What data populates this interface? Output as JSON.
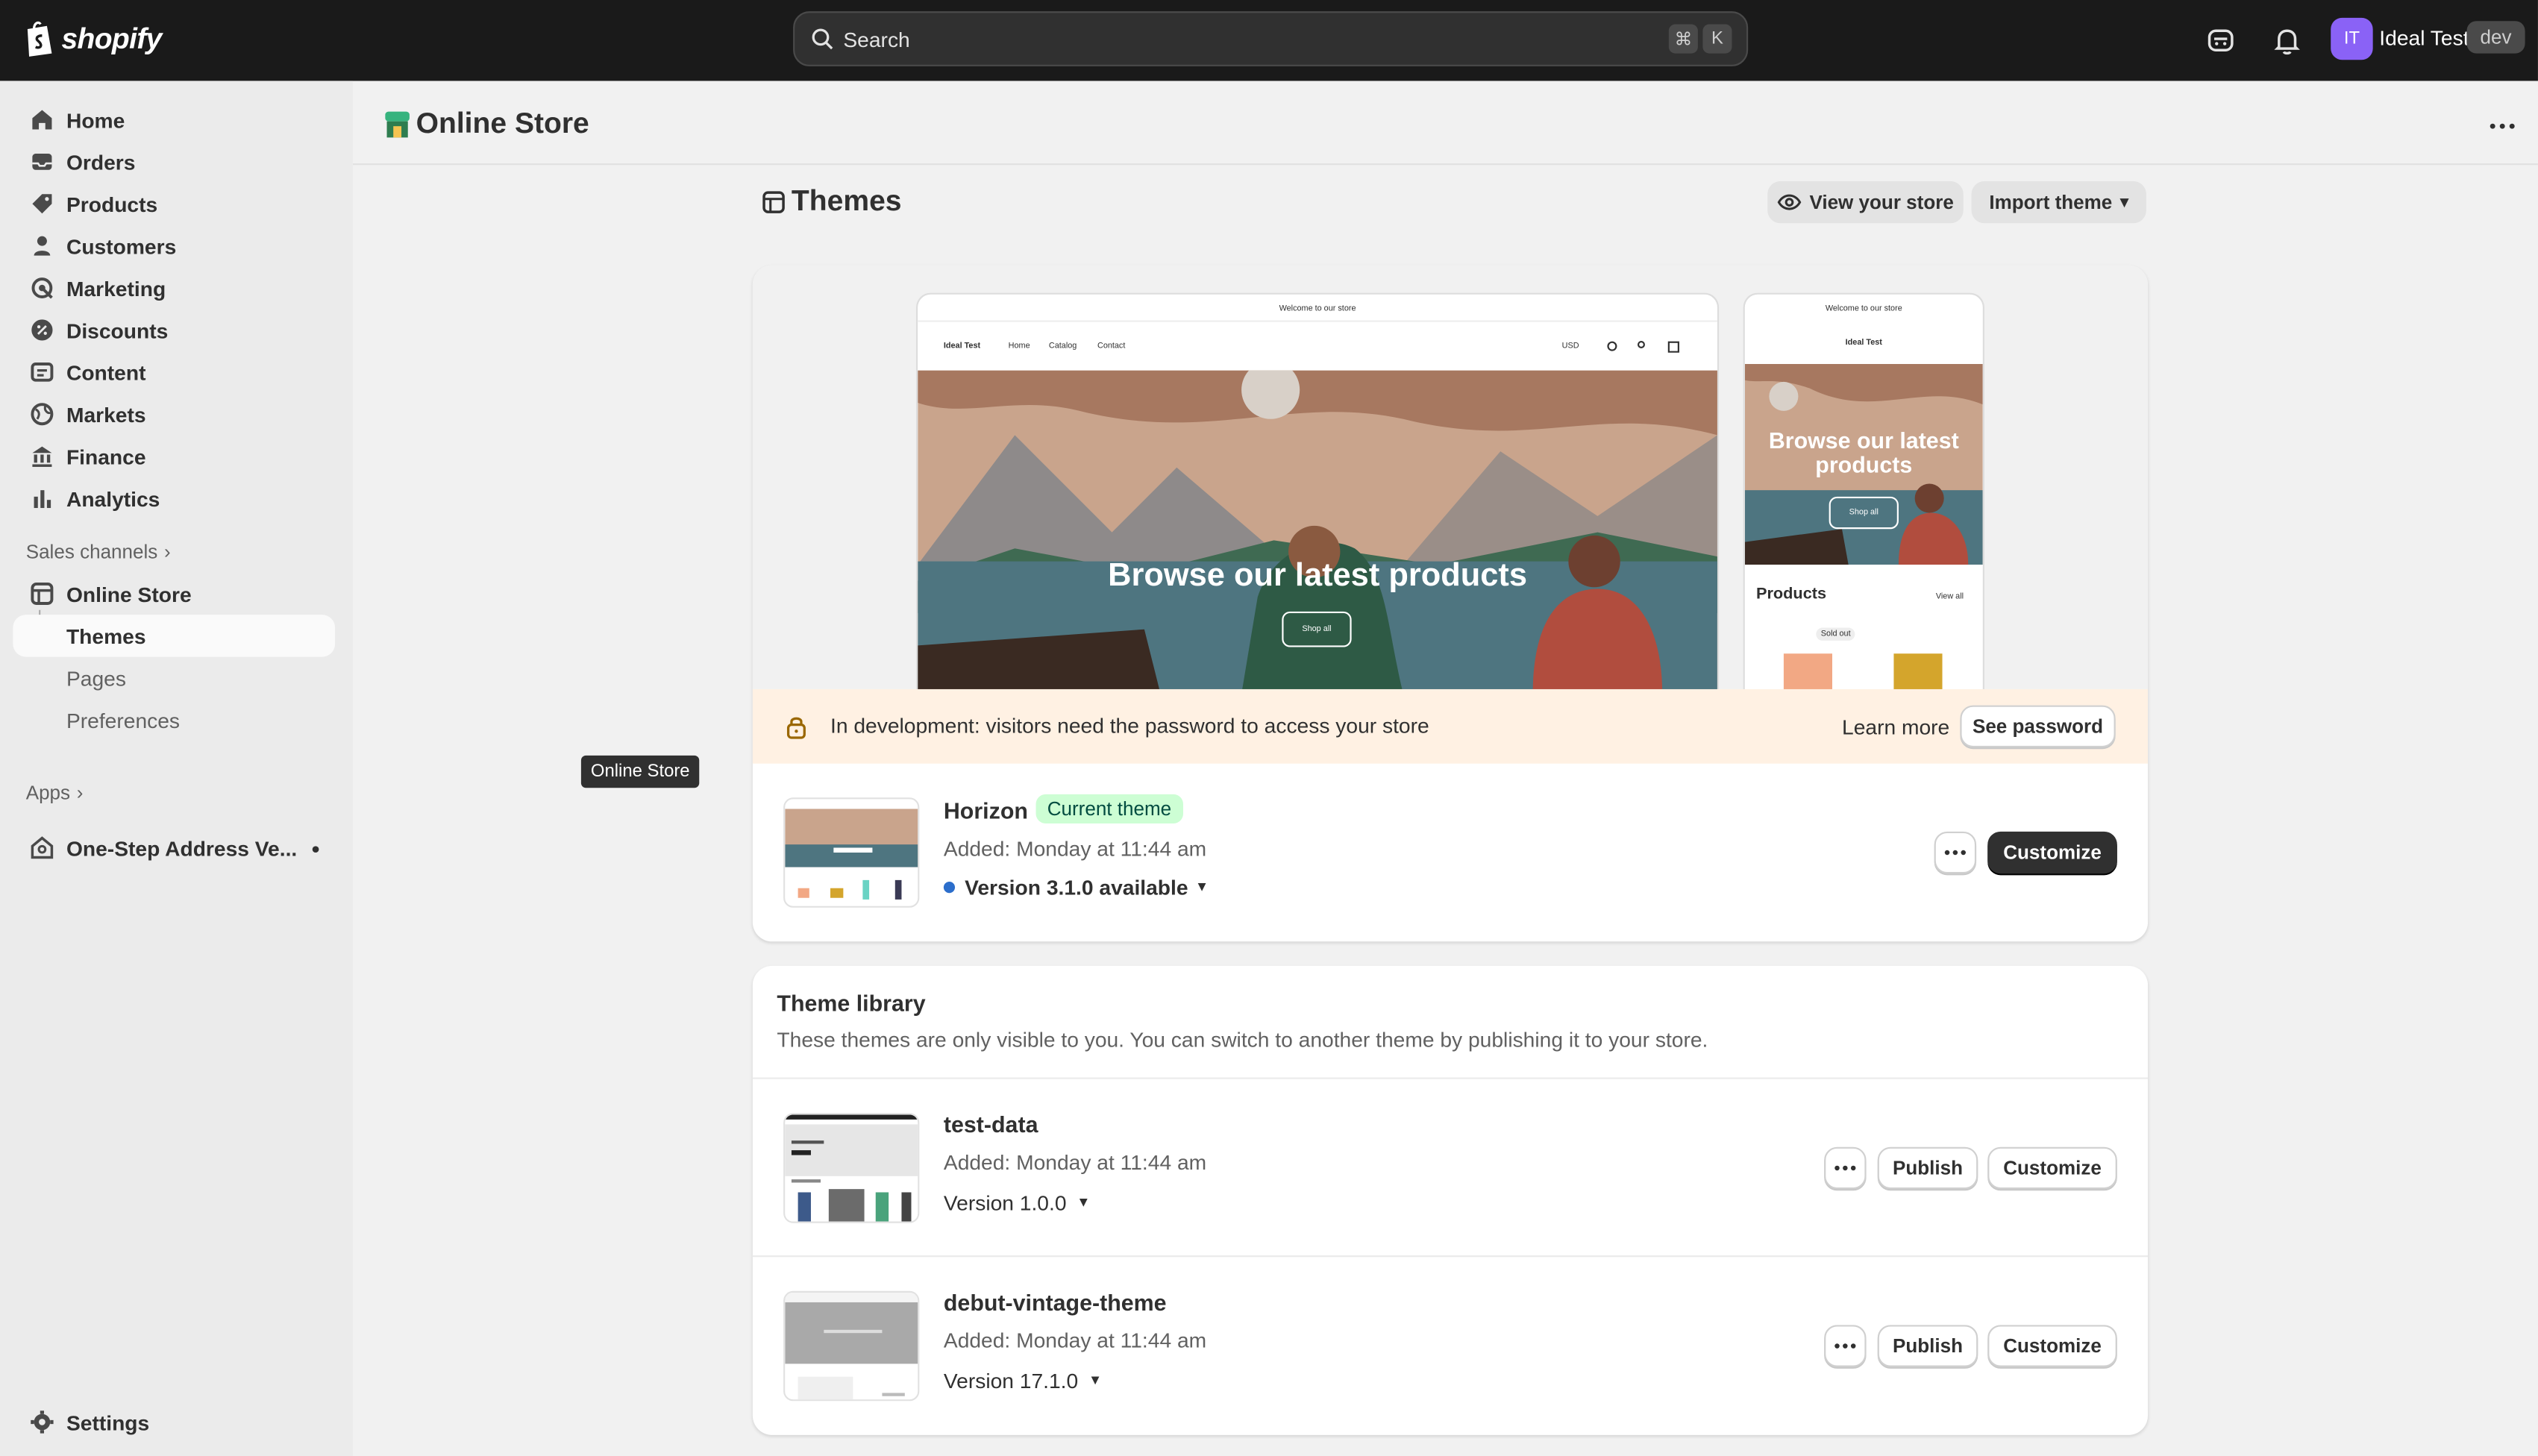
{
  "topbar": {
    "brand": "shopify",
    "search_placeholder": "Search",
    "shortcut_key1": "⌘",
    "shortcut_key2": "K",
    "avatar_initials": "IT",
    "user_name": "Ideal Test",
    "user_badge": "dev"
  },
  "sidebar": {
    "items": [
      {
        "label": "Home",
        "icon": "home-icon"
      },
      {
        "label": "Orders",
        "icon": "orders-icon"
      },
      {
        "label": "Products",
        "icon": "tag-icon"
      },
      {
        "label": "Customers",
        "icon": "person-icon"
      },
      {
        "label": "Marketing",
        "icon": "target-icon"
      },
      {
        "label": "Discounts",
        "icon": "discount-icon"
      },
      {
        "label": "Content",
        "icon": "content-icon"
      },
      {
        "label": "Markets",
        "icon": "globe-icon"
      },
      {
        "label": "Finance",
        "icon": "bank-icon"
      },
      {
        "label": "Analytics",
        "icon": "bar-chart-icon"
      }
    ],
    "sales_channels_label": "Sales channels",
    "online_store_label": "Online Store",
    "sub_items": [
      "Themes",
      "Pages",
      "Preferences"
    ],
    "apps_label": "Apps",
    "app_item_label": "One-Step Address Ve...",
    "settings_label": "Settings",
    "tooltip": "Online Store"
  },
  "main": {
    "page_title": "Online Store",
    "section_title": "Themes",
    "view_store_label": "View your store",
    "import_theme_label": "Import theme",
    "preview": {
      "announcement": "Welcome to our store",
      "store_name": "Ideal Test",
      "nav_links": [
        "Home",
        "Catalog",
        "Contact"
      ],
      "currency": "USD",
      "hero_heading": "Browse our latest products",
      "hero_button": "Shop all",
      "products_heading": "Products",
      "view_all": "View all",
      "sold_out": "Sold out"
    },
    "banner": {
      "text": "In development: visitors need the password to access your store",
      "learn_more": "Learn more",
      "see_password": "See password"
    },
    "current_theme": {
      "name": "Horizon",
      "badge": "Current theme",
      "added": "Added: Monday at 11:44 am",
      "version": "Version 3.1.0 available",
      "customize_label": "Customize"
    },
    "library": {
      "title": "Theme library",
      "description": "These themes are only visible to you. You can switch to another theme by publishing it to your store.",
      "themes": [
        {
          "name": "test-data",
          "added": "Added: Monday at 11:44 am",
          "version": "Version 1.0.0",
          "publish_label": "Publish",
          "customize_label": "Customize"
        },
        {
          "name": "debut-vintage-theme",
          "added": "Added: Monday at 11:44 am",
          "version": "Version 17.1.0",
          "publish_label": "Publish",
          "customize_label": "Customize"
        }
      ]
    }
  },
  "colors": {
    "topbar_bg": "#1a1a1a",
    "sidebar_bg": "#ebebeb",
    "page_bg": "#f1f1f1",
    "banner_bg": "#fff1e3",
    "badge_green": "#cdfed4",
    "avatar_purple": "#8a62f6",
    "update_dot": "#2c6ecb"
  }
}
